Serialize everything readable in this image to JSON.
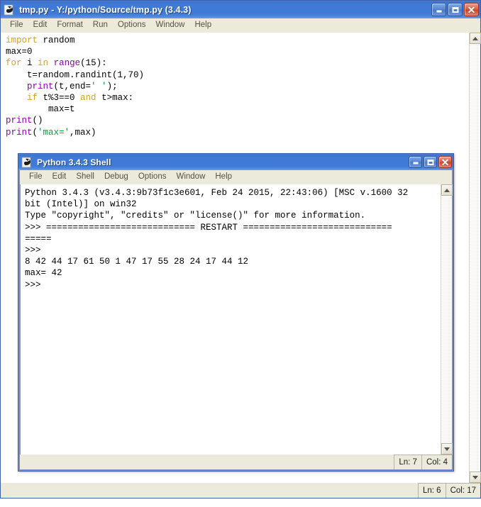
{
  "editor": {
    "title": "tmp.py - Y:/python/Source/tmp.py (3.4.3)",
    "icon": "python-idle-icon",
    "menus": [
      "File",
      "Edit",
      "Format",
      "Run",
      "Options",
      "Window",
      "Help"
    ],
    "buttons": {
      "minimize": "minimize-button",
      "maximize": "maximize-button",
      "close": "close-button",
      "close_glyph": "✕"
    },
    "status": {
      "line": "Ln: 6",
      "col": "Col: 17"
    },
    "code_lines": [
      [
        {
          "t": "import",
          "c": "kw"
        },
        {
          "t": " random",
          "c": "def"
        }
      ],
      [
        {
          "t": "max=0",
          "c": "def"
        }
      ],
      [
        {
          "t": "for",
          "c": "kw"
        },
        {
          "t": " i ",
          "c": "def"
        },
        {
          "t": "in",
          "c": "kw"
        },
        {
          "t": " ",
          "c": "def"
        },
        {
          "t": "range",
          "c": "bi"
        },
        {
          "t": "(15):",
          "c": "def"
        }
      ],
      [
        {
          "t": "    t=random.randint(1,70)",
          "c": "def"
        }
      ],
      [
        {
          "t": "    ",
          "c": "def"
        },
        {
          "t": "print",
          "c": "bi"
        },
        {
          "t": "(t,end=",
          "c": "def"
        },
        {
          "t": "' '",
          "c": "str"
        },
        {
          "t": ");",
          "c": "def"
        }
      ],
      [
        {
          "t": "    ",
          "c": "def"
        },
        {
          "t": "if",
          "c": "kw"
        },
        {
          "t": " t%3==0 ",
          "c": "def"
        },
        {
          "t": "and",
          "c": "kw"
        },
        {
          "t": " t>max:",
          "c": "def"
        }
      ],
      [
        {
          "t": "        max=t",
          "c": "def"
        }
      ],
      [
        {
          "t": "print",
          "c": "bi"
        },
        {
          "t": "()",
          "c": "def"
        }
      ],
      [
        {
          "t": "print",
          "c": "bi"
        },
        {
          "t": "(",
          "c": "def"
        },
        {
          "t": "'max='",
          "c": "str"
        },
        {
          "t": ",max)",
          "c": "def"
        }
      ]
    ]
  },
  "shell": {
    "title": "Python 3.4.3 Shell",
    "icon": "python-idle-icon",
    "menus": [
      "File",
      "Edit",
      "Shell",
      "Debug",
      "Options",
      "Window",
      "Help"
    ],
    "buttons": {
      "minimize": "minimize-button",
      "maximize": "maximize-button",
      "close": "close-button",
      "close_glyph": "✕"
    },
    "status": {
      "line": "Ln: 7",
      "col": "Col: 4"
    },
    "output_lines": [
      "Python 3.4.3 (v3.4.3:9b73f1c3e601, Feb 24 2015, 22:43:06) [MSC v.1600 32",
      "bit (Intel)] on win32",
      "Type \"copyright\", \"credits\" or \"license()\" for more information.",
      ">>> ============================ RESTART ============================",
      "=====",
      ">>> ",
      "8 42 44 17 61 50 1 47 17 55 28 24 17 44 12 ",
      "max= 42",
      ">>> "
    ]
  },
  "scrollbar": {
    "up_arrow": "scroll-up-arrow",
    "down_arrow": "scroll-down-arrow"
  }
}
